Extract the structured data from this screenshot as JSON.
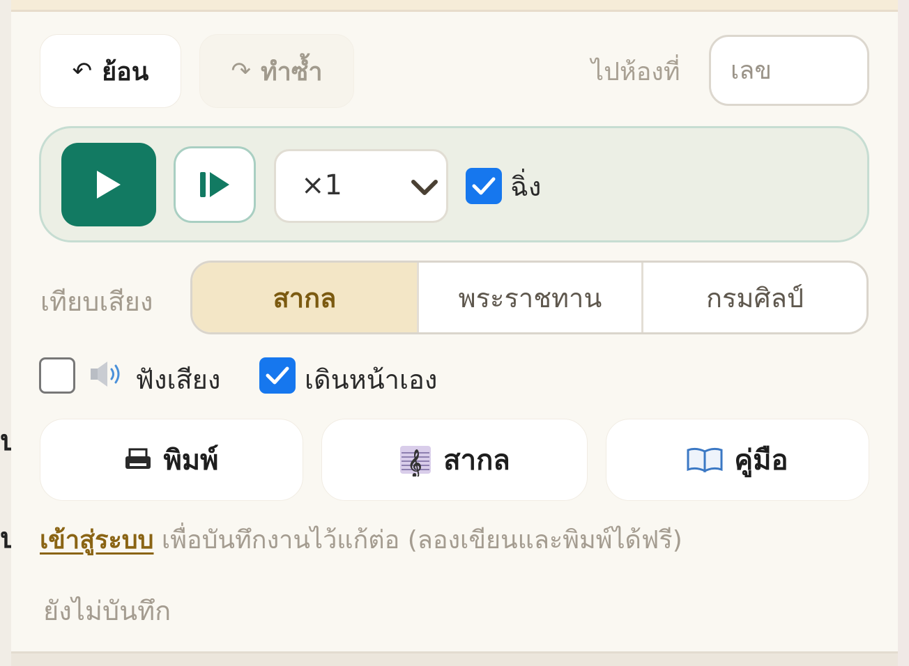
{
  "history": {
    "undo_label": "ย้อน",
    "redo_label": "ทำซ้ำ"
  },
  "goto_bar": {
    "label": "ไปห้องที่",
    "placeholder": "เลข"
  },
  "player": {
    "speed_value": "×1",
    "speed_options": [
      "×1"
    ],
    "hold_label": "ฉิ่ง",
    "hold_checked": true
  },
  "tuning": {
    "label": "เทียบเสียง",
    "options": [
      "สากล",
      "พระราชทาน",
      "กรมศิลป์"
    ],
    "selected": "สากล"
  },
  "toggles": {
    "listen_label": "ฟังเสียง",
    "listen_checked": false,
    "auto_advance_label": "เดินหน้าเอง",
    "auto_advance_checked": true
  },
  "actions": {
    "print_label": "พิมพ์",
    "notation_label": "สากล",
    "manual_label": "คู่มือ"
  },
  "footer": {
    "login_link": "เข้าสู่ระบบ",
    "login_note": " เพื่อบันทึกงานไว้แก้ต่อ (ลองเขียนและพิมพ์ได้ฟรี)",
    "save_status": "ยังไม่บันทึก"
  },
  "colors": {
    "accent_green": "#127a62",
    "checkbox_blue": "#1677ee",
    "selected_segment": "#f3e6c6",
    "link_brown": "#8a6414"
  }
}
